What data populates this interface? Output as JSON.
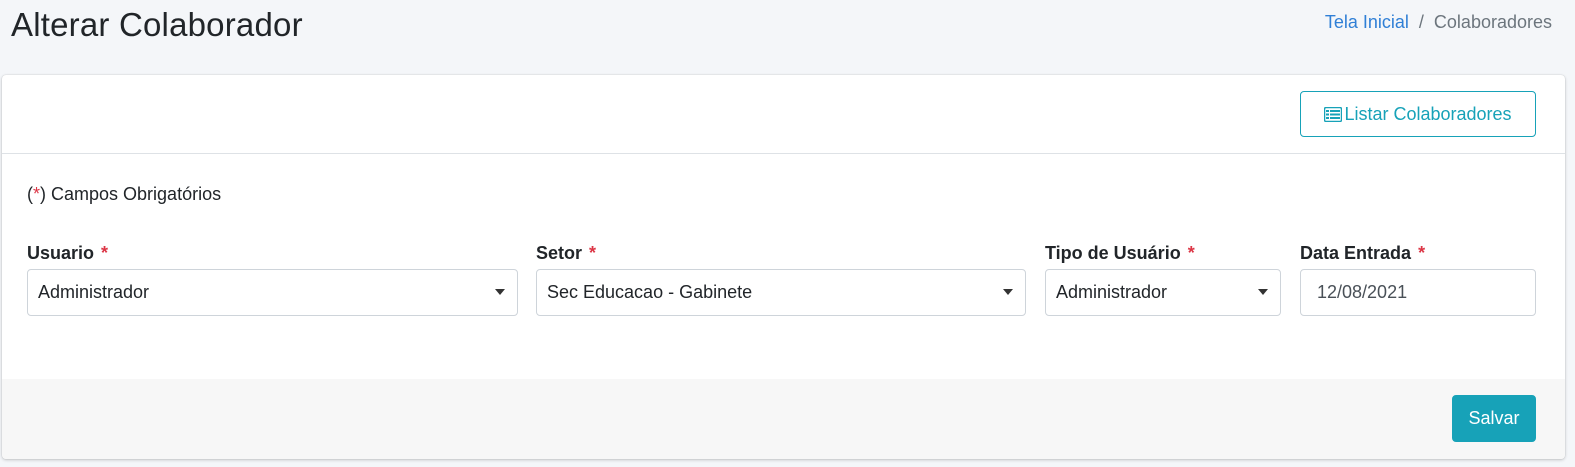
{
  "header": {
    "title": "Alterar Colaborador",
    "breadcrumb": {
      "home": "Tela Inicial",
      "separator": "/",
      "current": "Colaboradores"
    }
  },
  "card": {
    "list_button_label": "Listar Colaboradores",
    "list_button_icon": "list-icon",
    "required_note": {
      "open": "(",
      "star": "*",
      "close": ") Campos Obrigatórios"
    },
    "fields": {
      "usuario": {
        "label": "Usuario",
        "value": "Administrador"
      },
      "setor": {
        "label": "Setor",
        "value": "Sec Educacao - Gabinete"
      },
      "tipo_usuario": {
        "label": "Tipo de Usuário",
        "value": "Administrador"
      },
      "data_entrada": {
        "label": "Data Entrada",
        "value": "12/08/2021"
      }
    },
    "required_star": "*",
    "save_label": "Salvar"
  },
  "colors": {
    "accent": "#17a2b8",
    "link": "#2f7fd6",
    "required": "#dc3545"
  }
}
